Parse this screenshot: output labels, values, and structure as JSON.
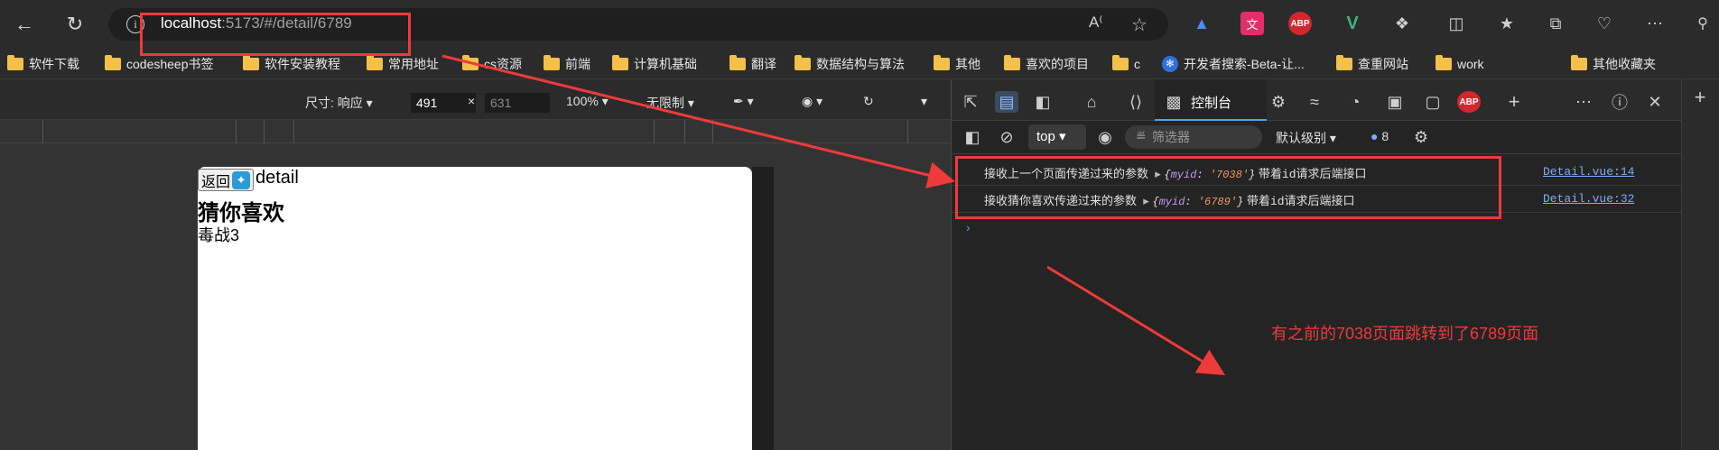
{
  "browser": {
    "url_host": "localhost",
    "url_path": ":5173/#/detail/6789",
    "ext_abp": "ABP",
    "ext_v": "V"
  },
  "bookmarks": [
    {
      "label": "软件下载"
    },
    {
      "label": "codesheep书签"
    },
    {
      "label": "软件安装教程"
    },
    {
      "label": "常用地址"
    },
    {
      "label": "cs资源"
    },
    {
      "label": "前端"
    },
    {
      "label": "计算机基础"
    },
    {
      "label": "翻译"
    },
    {
      "label": "数据结构与算法"
    },
    {
      "label": "其他"
    },
    {
      "label": "喜欢的项目"
    },
    {
      "label": "c"
    },
    {
      "label": "开发者搜索-Beta-让..."
    },
    {
      "label": "查重网站"
    },
    {
      "label": "work"
    },
    {
      "label": "其他收藏夹"
    }
  ],
  "device_toolbar": {
    "size_label": "尺寸: 响应",
    "width": "491",
    "times": "×",
    "height": "631",
    "zoom": "100%",
    "throttle": "无限制"
  },
  "page": {
    "back_label": "返回",
    "detail_title": "detail",
    "guess_heading": "猜你喜欢",
    "guess_item": "毒战3"
  },
  "devtools": {
    "console_tab": "控制台",
    "context": "top",
    "filter_placeholder": "筛选器",
    "level": "默认级别",
    "issues_count": "8",
    "abp": "ABP",
    "logs": [
      {
        "message": "接收上一个页面传递过来的参数",
        "obj_key": "myid",
        "obj_value": "'7038'",
        "suffix_a": "带着",
        "suffix_id": "id",
        "suffix_b": "请求后端接口",
        "source": "Detail.vue:14"
      },
      {
        "message": "接收猜你喜欢传递过来的参数",
        "obj_key": "myid",
        "obj_value": "'6789'",
        "suffix_a": "带着",
        "suffix_id": "id",
        "suffix_b": "请求后端接口",
        "source": "Detail.vue:32"
      }
    ]
  },
  "annotation": {
    "text": "有之前的7038页面跳转到了6789页面",
    "color": "#ee3a3a"
  },
  "colors": {
    "accent": "#4ea3ff",
    "folder": "#f3c04a",
    "annotation": "#ee3a3a"
  }
}
